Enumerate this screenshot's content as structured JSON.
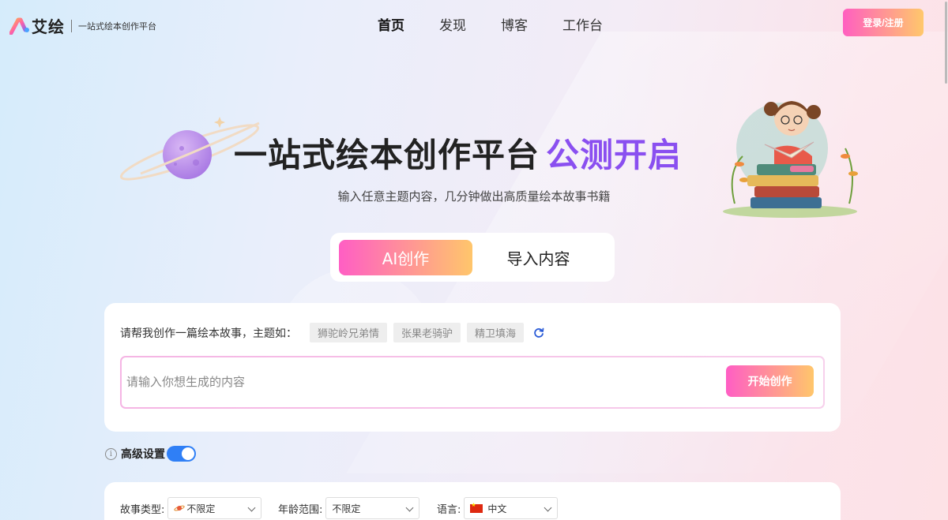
{
  "header": {
    "logo_text": "艾绘",
    "logo_sub": "一站式绘本创作平台",
    "nav": [
      {
        "label": "首页"
      },
      {
        "label": "发现"
      },
      {
        "label": "博客"
      },
      {
        "label": "工作台"
      }
    ],
    "login_label": "登录/注册"
  },
  "hero": {
    "title_main": "一站式绘本创作平台",
    "title_accent": "公测开启",
    "subtitle": "输入任意主题内容，几分钟做出高质量绘本故事书籍"
  },
  "mode_tabs": [
    {
      "label": "AI创作",
      "active": true
    },
    {
      "label": "导入内容",
      "active": false
    }
  ],
  "prompt": {
    "label": "请帮我创作一篇绘本故事，主题如：",
    "chips": [
      "狮驼岭兄弟情",
      "张果老骑驴",
      "精卫填海"
    ],
    "refresh_icon": "refresh-icon",
    "input_value": "",
    "input_placeholder": "请输入你想生成的内容",
    "start_label": "开始创作"
  },
  "advanced": {
    "label": "高级设置",
    "info_glyph": "i",
    "enabled": true
  },
  "settings": {
    "story_type": {
      "label": "故事类型:",
      "value": "不限定"
    },
    "age_range": {
      "label": "年龄范围:",
      "value": "不限定"
    },
    "language": {
      "label": "语言:",
      "value": "中文"
    }
  },
  "colors": {
    "accent_purple": "#8a4ff0",
    "gradient_start": "#ff5ec4",
    "gradient_end": "#ffc66b",
    "toggle_blue": "#2f7ff6"
  }
}
